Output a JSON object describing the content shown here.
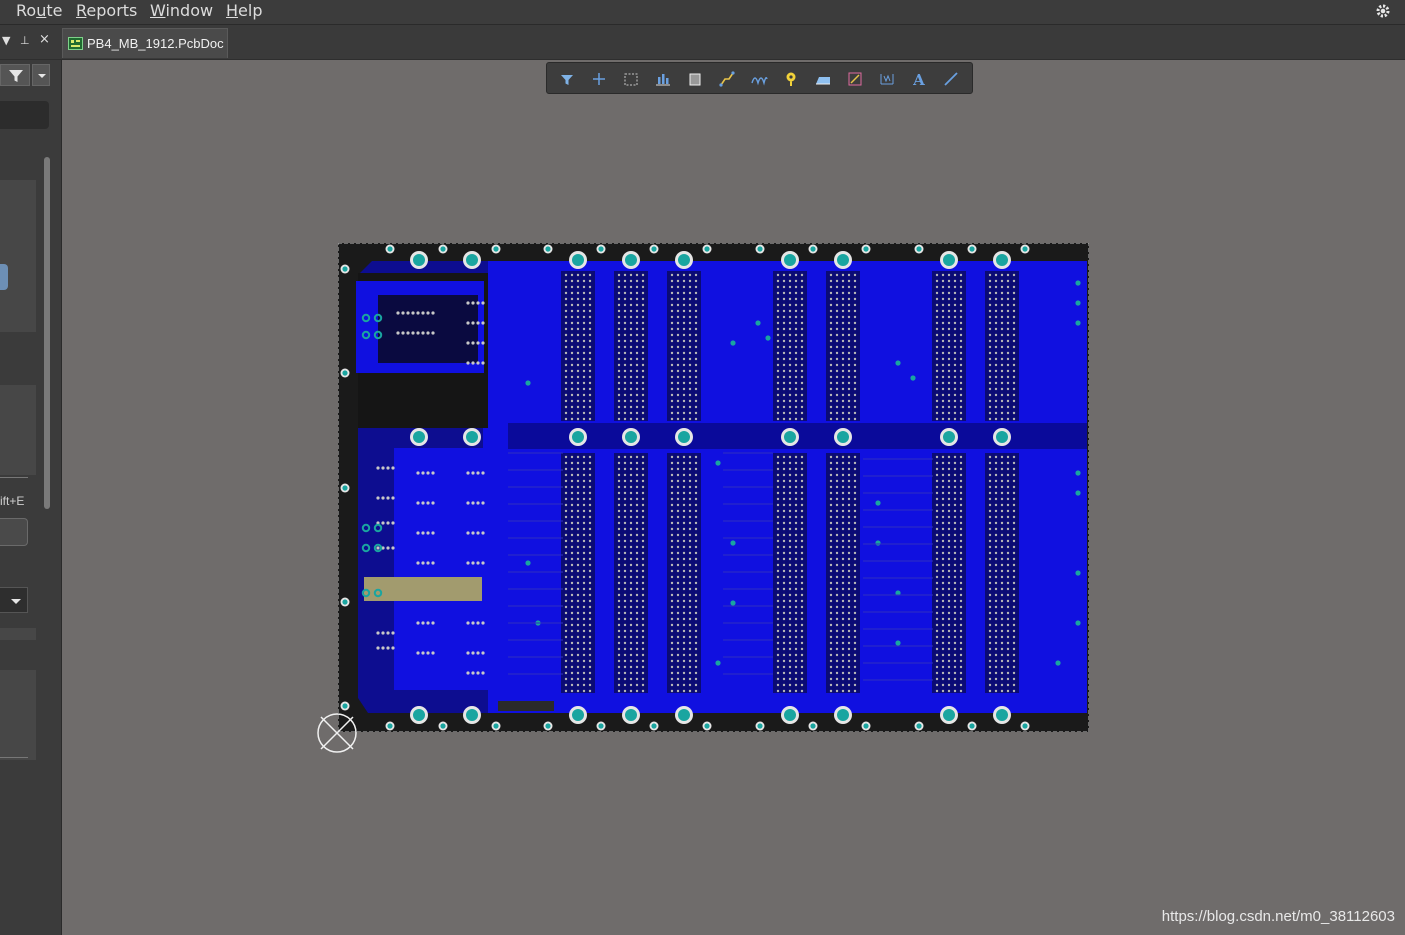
{
  "menubar": {
    "items": [
      {
        "label": "Route",
        "underline_index": 2
      },
      {
        "label": "Reports",
        "underline_index": 0
      },
      {
        "label": "Window",
        "underline_index": 0
      },
      {
        "label": "Help",
        "underline_index": 0
      }
    ]
  },
  "tabs": [
    {
      "label": "PB4_MB_1912.PcbDoc",
      "active": true
    }
  ],
  "left_panel": {
    "shortcut_text": "ift+E"
  },
  "toolbar": {
    "tools": [
      {
        "icon": "filter-icon",
        "color": "#7fb2e6"
      },
      {
        "icon": "crosshair-add-icon",
        "color": "#6aa0e0"
      },
      {
        "icon": "select-rect-icon",
        "color": "#bbbbbb"
      },
      {
        "icon": "align-icon",
        "color": "#6aa0e0"
      },
      {
        "icon": "component-place-icon",
        "color": "#cccccc"
      },
      {
        "icon": "route-track-icon",
        "color": "#e8c44a"
      },
      {
        "icon": "interactive-diff-route-icon",
        "color": "#6aa0e0"
      },
      {
        "icon": "via-place-icon",
        "color": "#f2d23a"
      },
      {
        "icon": "polygon-pour-icon",
        "color": "#6aa0e0"
      },
      {
        "icon": "region-icon",
        "color": "#e06aa0"
      },
      {
        "icon": "dimension-icon",
        "color": "#6aa0e0"
      },
      {
        "icon": "string-text-icon",
        "color": "#6aa0e0"
      },
      {
        "icon": "line-icon",
        "color": "#6aa0e0"
      }
    ]
  },
  "pcb": {
    "board_color": "#1010e0",
    "outline_color": "#1a1a1a",
    "pad_color": "#1aa5a0"
  },
  "watermark": "https://blog.csdn.net/m0_38112603"
}
